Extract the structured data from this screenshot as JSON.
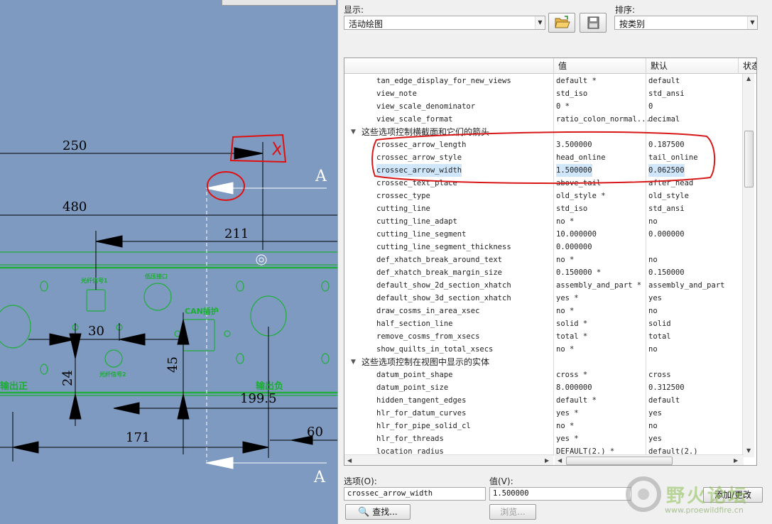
{
  "drawing": {
    "dims": [
      "250",
      "480",
      "211",
      "30",
      "45",
      "24",
      "199.5",
      "171",
      "60"
    ],
    "section_labels": [
      "A",
      "A"
    ],
    "part_labels": {
      "p1": "光纤信号1",
      "p2": "低压接口",
      "p3": "CAN插护",
      "p4": "光纤信号2",
      "p5": "输出正",
      "p6": "输出负"
    }
  },
  "dialog": {
    "show_label": "显示:",
    "show_value": "活动绘图",
    "sort_label": "排序:",
    "sort_value": "按类别",
    "open_icon": "folder-open-icon",
    "save_icon": "save-icon",
    "columns": [
      "值",
      "默认",
      "状态"
    ],
    "rows": [
      {
        "type": "opt",
        "name": "tan_edge_display_for_new_views",
        "value": "default *",
        "default": "default",
        "status": "●"
      },
      {
        "type": "opt",
        "name": "view_note",
        "value": "std_iso",
        "default": "std_ansi",
        "status": "●"
      },
      {
        "type": "opt",
        "name": "view_scale_denominator",
        "value": "0 *",
        "default": "0",
        "status": "●"
      },
      {
        "type": "opt",
        "name": "view_scale_format",
        "value": "ratio_colon_normal...",
        "default": "decimal",
        "status": "●"
      },
      {
        "type": "group",
        "name": "这些选项控制横截面和它们的箭头"
      },
      {
        "type": "opt",
        "name": "crossec_arrow_length",
        "value": "3.500000",
        "default": "0.187500",
        "status": "●"
      },
      {
        "type": "opt",
        "name": "crossec_arrow_style",
        "value": "head_online",
        "default": "tail_online",
        "status": "●"
      },
      {
        "type": "opt",
        "name": "crossec_arrow_width",
        "value": "1.500000",
        "default": "0.062500",
        "status": "●",
        "selected": true
      },
      {
        "type": "opt",
        "name": "crossec_text_place",
        "value": "above_tail",
        "default": "after_head",
        "status": "●"
      },
      {
        "type": "opt",
        "name": "crossec_type",
        "value": "old_style *",
        "default": "old_style",
        "status": "●"
      },
      {
        "type": "opt",
        "name": "cutting_line",
        "value": "std_iso",
        "default": "std_ansi",
        "status": "●"
      },
      {
        "type": "opt",
        "name": "cutting_line_adapt",
        "value": "no *",
        "default": "no",
        "status": "●"
      },
      {
        "type": "opt",
        "name": "cutting_line_segment",
        "value": "10.000000",
        "default": "0.000000",
        "status": "●"
      },
      {
        "type": "opt",
        "name": "cutting_line_segment_thickness",
        "value": "0.000000",
        "default": "",
        "status": "●"
      },
      {
        "type": "opt",
        "name": "def_xhatch_break_around_text",
        "value": "no *",
        "default": "no",
        "status": "●"
      },
      {
        "type": "opt",
        "name": "def_xhatch_break_margin_size",
        "value": "0.150000 *",
        "default": "0.150000",
        "status": "●"
      },
      {
        "type": "opt",
        "name": "default_show_2d_section_xhatch",
        "value": "assembly_and_part *",
        "default": "assembly_and_part",
        "status": "●"
      },
      {
        "type": "opt",
        "name": "default_show_3d_section_xhatch",
        "value": "yes *",
        "default": "yes",
        "status": "●"
      },
      {
        "type": "opt",
        "name": "draw_cosms_in_area_xsec",
        "value": "no *",
        "default": "no",
        "status": "●"
      },
      {
        "type": "opt",
        "name": "half_section_line",
        "value": "solid *",
        "default": "solid",
        "status": "●"
      },
      {
        "type": "opt",
        "name": "remove_cosms_from_xsecs",
        "value": "total *",
        "default": "total",
        "status": "●"
      },
      {
        "type": "opt",
        "name": "show_quilts_in_total_xsecs",
        "value": "no *",
        "default": "no",
        "status": "●"
      },
      {
        "type": "group",
        "name": "这些选项控制在视图中显示的实体"
      },
      {
        "type": "opt",
        "name": "datum_point_shape",
        "value": "cross *",
        "default": "cross",
        "status": "●"
      },
      {
        "type": "opt",
        "name": "datum_point_size",
        "value": "8.000000",
        "default": "0.312500",
        "status": "●"
      },
      {
        "type": "opt",
        "name": "hidden_tangent_edges",
        "value": "default *",
        "default": "default",
        "status": "●"
      },
      {
        "type": "opt",
        "name": "hlr_for_datum_curves",
        "value": "yes *",
        "default": "yes",
        "status": "●"
      },
      {
        "type": "opt",
        "name": "hlr_for_pipe_solid_cl",
        "value": "no *",
        "default": "no",
        "status": "●"
      },
      {
        "type": "opt",
        "name": "hlr_for_threads",
        "value": "yes *",
        "default": "yes",
        "status": "●"
      },
      {
        "type": "opt",
        "name": "location_radius",
        "value": "DEFAULT(2.) *",
        "default": "default(2.)",
        "status": "●"
      }
    ],
    "option_label": "选项(O):",
    "option_value": "crossec_arrow_width",
    "value_label": "值(V):",
    "value_value": "1.500000",
    "find_label": "查找...",
    "browse_label": "浏览...",
    "add_change_label": "添加/更改"
  },
  "watermark": {
    "name": "野火论坛",
    "url": "www.proewildfire.cn"
  }
}
